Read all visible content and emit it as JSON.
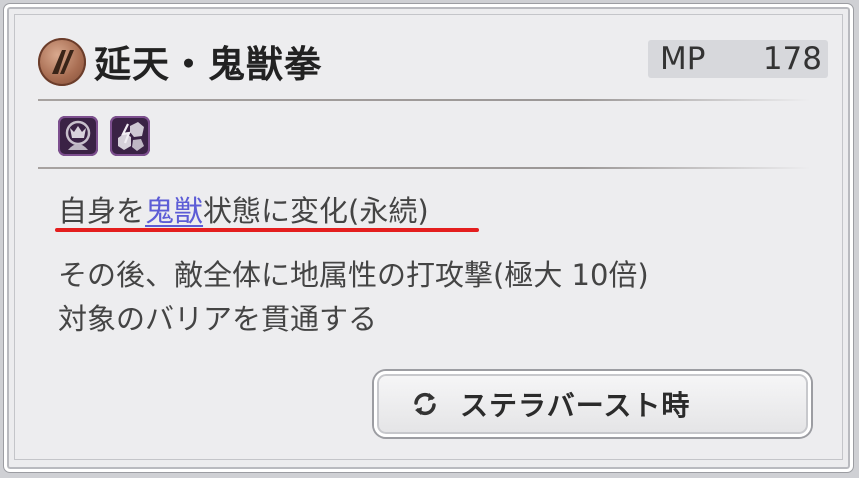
{
  "skill": {
    "name": "延天・鬼獣拳",
    "icon": "earth-slash-icon",
    "mp_label": "MP",
    "mp_value": "178"
  },
  "attributes": [
    {
      "icon": "beast-form-icon"
    },
    {
      "icon": "earth-element-icon"
    }
  ],
  "description": {
    "line1_prefix": "自身を",
    "line1_keyword": "鬼獣",
    "line1_suffix": "状態に変化(永続)",
    "line2": "その後、敵全体に地属性の打攻撃(極大 10倍)",
    "line3": "対象のバリアを貫通する"
  },
  "button": {
    "label": "ステラバースト時",
    "icon": "refresh-icon"
  },
  "colors": {
    "keyword": "#5c5cd6",
    "highlight_underline": "#e41e1e",
    "mp_box": "#d7d8dc"
  }
}
